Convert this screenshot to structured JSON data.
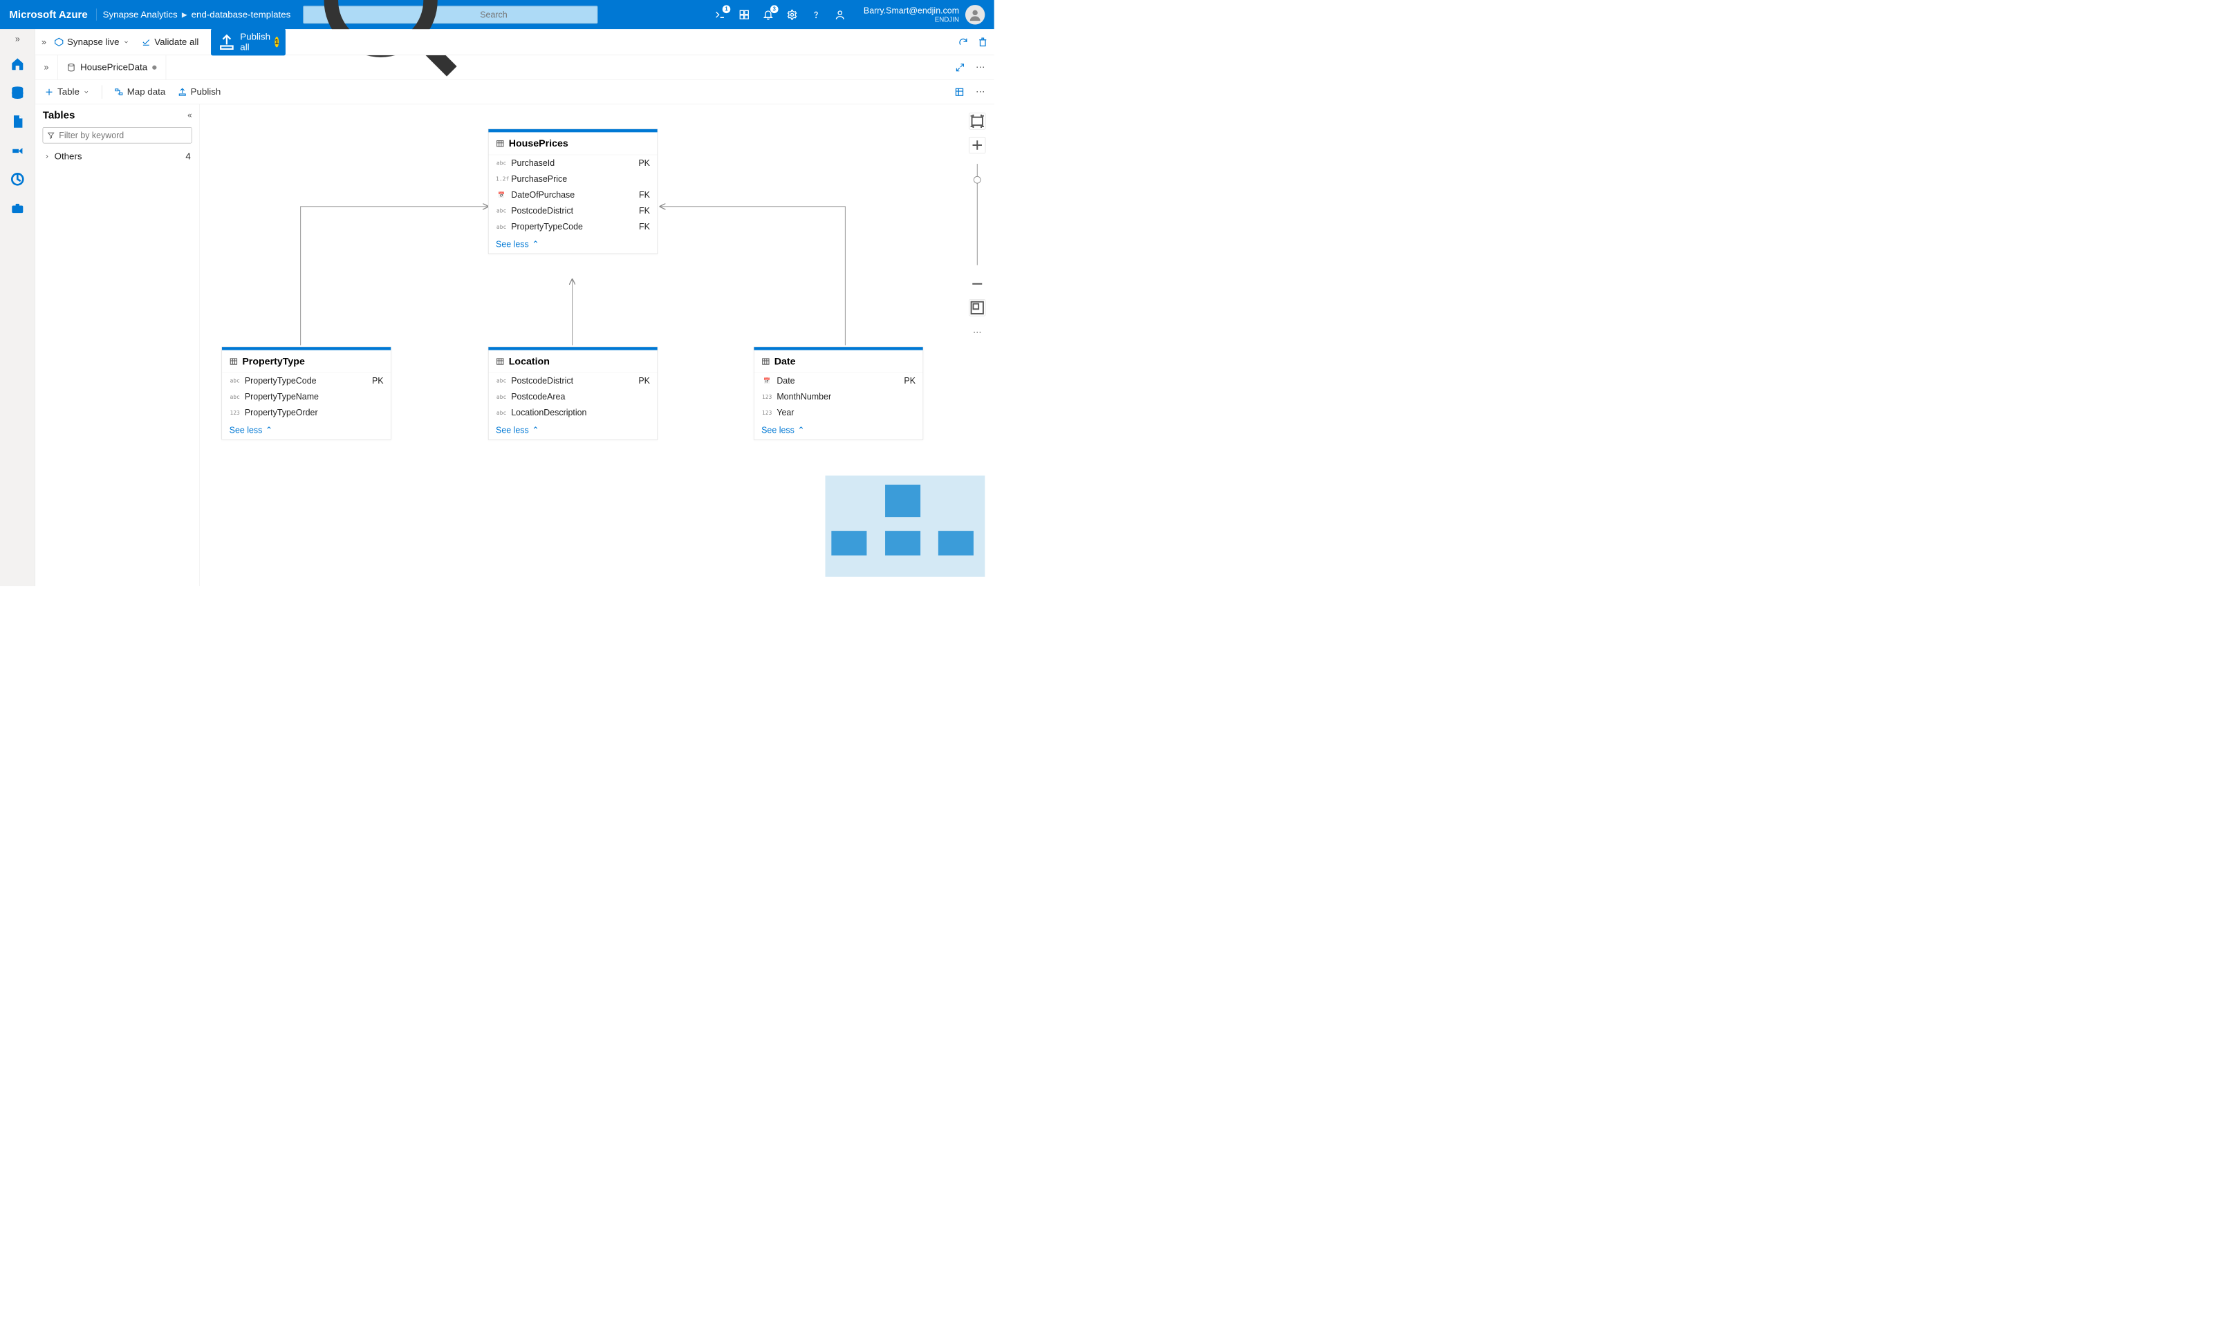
{
  "header": {
    "brand": "Microsoft Azure",
    "crumb1": "Synapse Analytics",
    "crumb2": "end-database-templates",
    "search_placeholder": "Search",
    "notif1_badge": "1",
    "notif2_badge": "3",
    "user_email": "Barry.Smart@endjin.com",
    "user_tenant": "ENDJIN"
  },
  "toolbar": {
    "synapse_live": "Synapse live",
    "validate_all": "Validate all",
    "publish_all": "Publish all",
    "publish_count": "1"
  },
  "tab": {
    "name": "HousePriceData"
  },
  "toolbar2": {
    "table": "Table",
    "map_data": "Map data",
    "publish": "Publish"
  },
  "tables_panel": {
    "title": "Tables",
    "filter_placeholder": "Filter by keyword",
    "group_label": "Others",
    "group_count": "4"
  },
  "entities": {
    "house_prices": {
      "name": "HousePrices",
      "see_less": "See less",
      "cols": [
        {
          "icon": "abc",
          "name": "PurchaseId",
          "key": "PK"
        },
        {
          "icon": "1.2f",
          "name": "PurchasePrice",
          "key": ""
        },
        {
          "icon": "cal",
          "name": "DateOfPurchase",
          "key": "FK"
        },
        {
          "icon": "abc",
          "name": "PostcodeDistrict",
          "key": "FK"
        },
        {
          "icon": "abc",
          "name": "PropertyTypeCode",
          "key": "FK"
        }
      ]
    },
    "property_type": {
      "name": "PropertyType",
      "see_less": "See less",
      "cols": [
        {
          "icon": "abc",
          "name": "PropertyTypeCode",
          "key": "PK"
        },
        {
          "icon": "abc",
          "name": "PropertyTypeName",
          "key": ""
        },
        {
          "icon": "123",
          "name": "PropertyTypeOrder",
          "key": ""
        }
      ]
    },
    "location": {
      "name": "Location",
      "see_less": "See less",
      "cols": [
        {
          "icon": "abc",
          "name": "PostcodeDistrict",
          "key": "PK"
        },
        {
          "icon": "abc",
          "name": "PostcodeArea",
          "key": ""
        },
        {
          "icon": "abc",
          "name": "LocationDescription",
          "key": ""
        }
      ]
    },
    "date": {
      "name": "Date",
      "see_less": "See less",
      "cols": [
        {
          "icon": "cal",
          "name": "Date",
          "key": "PK"
        },
        {
          "icon": "123",
          "name": "MonthNumber",
          "key": ""
        },
        {
          "icon": "123",
          "name": "Year",
          "key": ""
        }
      ]
    }
  }
}
